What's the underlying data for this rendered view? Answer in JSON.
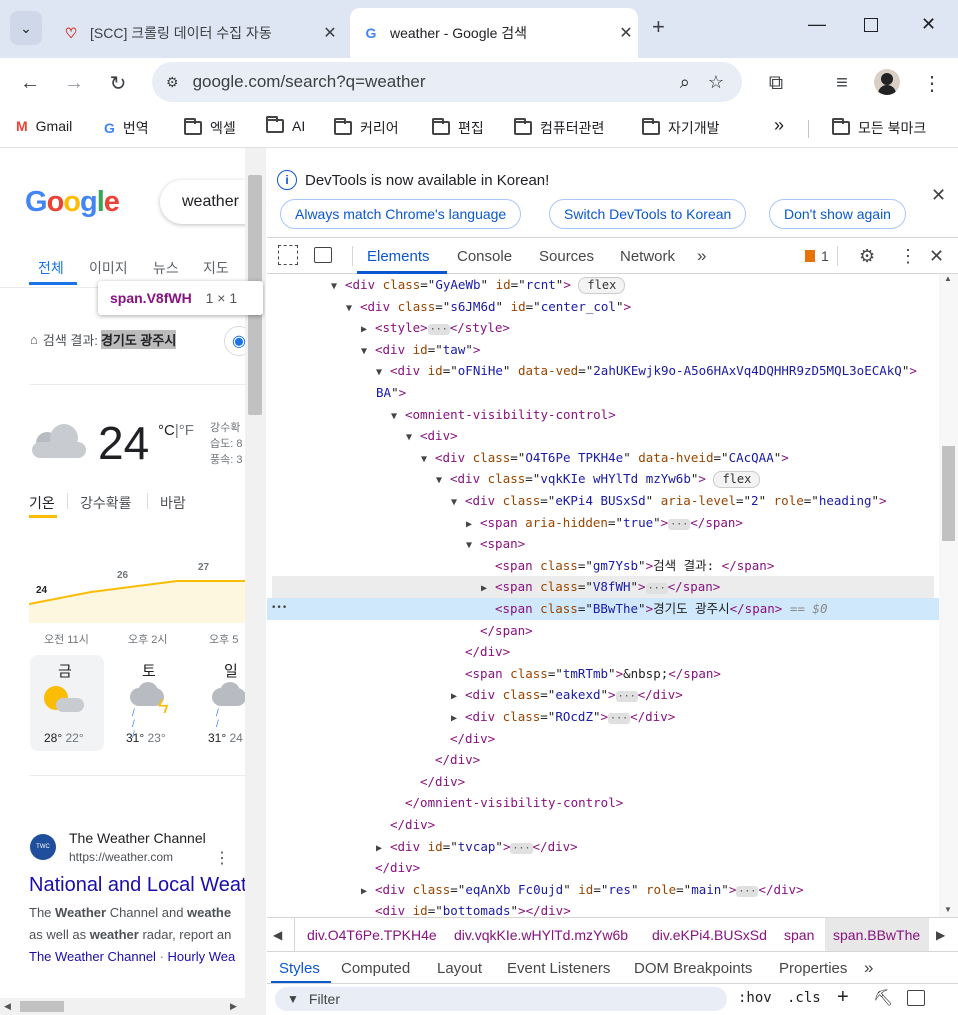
{
  "browser": {
    "tabs": [
      {
        "title": "[SCC] 크롤링 데이터 수집 자동"
      },
      {
        "title": "weather - Google 검색"
      }
    ],
    "url": "google.com/search?q=weather",
    "bookmarks": [
      "Gmail",
      "번역",
      "엑셀",
      "AI",
      "커리어",
      "편집",
      "컴퓨터관련",
      "자기개발"
    ],
    "all_bookmarks": "모든 북마크",
    "more": "»"
  },
  "page": {
    "logo": "Google",
    "search_query": "weather",
    "tabs": [
      "전체",
      "이미지",
      "뉴스",
      "지도"
    ],
    "tooltip": {
      "selector": "span.V8fWH",
      "size": "1 × 1"
    },
    "result_prefix": "검색 결과:",
    "location": "경기도 광주시",
    "temperature": "24",
    "unit_c": "°C",
    "unit_sep": "|",
    "unit_f": "°F",
    "details": [
      "강수확",
      "습도: 8",
      "풍속: 3"
    ],
    "weather_tabs": [
      "기온",
      "강수확률",
      "바람"
    ],
    "chart_labels": [
      "24",
      "26",
      "27"
    ],
    "times": [
      "오전 11시",
      "오후 2시",
      "오후 5"
    ],
    "days": [
      {
        "name": "금",
        "hi": "28°",
        "lo": "22°"
      },
      {
        "name": "토",
        "hi": "31°",
        "lo": "23°"
      },
      {
        "name": "일",
        "hi": "31°",
        "lo": "24"
      }
    ],
    "result": {
      "site": "The Weather Channel",
      "url": "https://weather.com",
      "title": "National and Local Weat",
      "snippet1_a": "The ",
      "snippet1_b": "Weather",
      "snippet1_c": " Channel and ",
      "snippet1_d": "weathe",
      "snippet2_a": "as well as ",
      "snippet2_b": "weather",
      "snippet2_c": " radar, report an",
      "link1": "The Weather Channel",
      "link_sep": " · ",
      "link2": "Hourly Wea"
    }
  },
  "devtools": {
    "banner_text": "DevTools is now available in Korean!",
    "banner_buttons": [
      "Always match Chrome's language",
      "Switch DevTools to Korean",
      "Don't show again"
    ],
    "tabs": [
      "Elements",
      "Console",
      "Sources",
      "Network"
    ],
    "issues_count": "1",
    "breadcrumbs": [
      "div.O4T6Pe.TPKH4e",
      "div.vqkKIe.wHYlTd.mzYw6b",
      "div.eKPi4.BUSxSd",
      "span",
      "span.BBwThe"
    ],
    "style_tabs": [
      "Styles",
      "Computed",
      "Layout",
      "Event Listeners",
      "DOM Breakpoints",
      "Properties"
    ],
    "filter_placeholder": "Filter",
    "hov": ":hov",
    "cls": ".cls",
    "dom_lines": [
      {
        "arrow": "▼",
        "tag": "div",
        "attrs": [
          [
            "class",
            "GyAeWb"
          ],
          [
            "id",
            "rcnt"
          ]
        ],
        "badge": "flex"
      },
      {
        "arrow": "▼",
        "tag": "div",
        "attrs": [
          [
            "class",
            "s6JM6d"
          ],
          [
            "id",
            "center_col"
          ]
        ]
      },
      {
        "arrow": "▶",
        "tag": "style",
        "collapsed": true
      },
      {
        "arrow": "▼",
        "tag": "div",
        "attrs": [
          [
            "id",
            "taw"
          ]
        ]
      },
      {
        "arrow": "▼",
        "tag": "div",
        "attrs": [
          [
            "id",
            "oFNiHe"
          ],
          [
            "data-ved",
            "2ahUKEwjk9o-A5o6HAxVq4DQHHR9zD5MQL3oECAkQ"
          ]
        ],
        "wrap": "BA"
      },
      {
        "arrow": "▼",
        "tag": "omnient-visibility-control",
        "attrs": []
      },
      {
        "arrow": "▼",
        "tag": "div",
        "attrs": []
      },
      {
        "arrow": "▼",
        "tag": "div",
        "attrs": [
          [
            "class",
            "O4T6Pe TPKH4e"
          ],
          [
            "data-hveid",
            "CAcQAA"
          ]
        ]
      },
      {
        "arrow": "▼",
        "tag": "div",
        "attrs": [
          [
            "class",
            "vqkKIe wHYlTd mzYw6b"
          ]
        ],
        "badge": "flex"
      },
      {
        "arrow": "▼",
        "tag": "div",
        "attrs": [
          [
            "class",
            "eKPi4 BUSxSd"
          ],
          [
            "aria-level",
            "2"
          ],
          [
            "role",
            "heading"
          ]
        ]
      },
      {
        "arrow": "▶",
        "tag": "span",
        "attrs": [
          [
            "aria-hidden",
            "true"
          ]
        ],
        "collapsed": true
      },
      {
        "arrow": "▼",
        "tag": "span",
        "attrs": []
      },
      {
        "arrow": "",
        "tag": "span",
        "attrs": [
          [
            "class",
            "gm7Ysb"
          ]
        ],
        "text": "검색 결과: "
      },
      {
        "arrow": "▶",
        "tag": "span",
        "attrs": [
          [
            "class",
            "V8fWH"
          ]
        ],
        "collapsed": true
      },
      {
        "arrow": "",
        "tag": "span",
        "attrs": [
          [
            "class",
            "BBwThe"
          ]
        ],
        "text": "경기도 광주시",
        "selected": true,
        "eq": "== $0"
      },
      {
        "close": "span"
      },
      {
        "close": "div"
      },
      {
        "arrow": "",
        "tag": "span",
        "attrs": [
          [
            "class",
            "tmRTmb"
          ]
        ],
        "text": "&nbsp;"
      },
      {
        "arrow": "▶",
        "tag": "div",
        "attrs": [
          [
            "class",
            "eakexd"
          ]
        ],
        "collapsed": true
      },
      {
        "arrow": "▶",
        "tag": "div",
        "attrs": [
          [
            "class",
            "ROcdZ"
          ]
        ],
        "collapsed": true
      },
      {
        "close": "div"
      },
      {
        "close": "div"
      },
      {
        "close": "div"
      },
      {
        "close": "omnient-visibility-control"
      },
      {
        "close": "div"
      },
      {
        "arrow": "▶",
        "tag": "div",
        "attrs": [
          [
            "id",
            "tvcap"
          ]
        ],
        "collapsed": true
      },
      {
        "close": "div"
      },
      {
        "arrow": "▶",
        "tag": "div",
        "attrs": [
          [
            "class",
            "eqAnXb Fc0ujd"
          ],
          [
            "id",
            "res"
          ],
          [
            "role",
            "main"
          ]
        ],
        "collapsed": true
      },
      {
        "arrow": "",
        "tag": "div",
        "attrs": [
          [
            "id",
            "bottomads"
          ]
        ],
        "open_close": true
      }
    ]
  }
}
